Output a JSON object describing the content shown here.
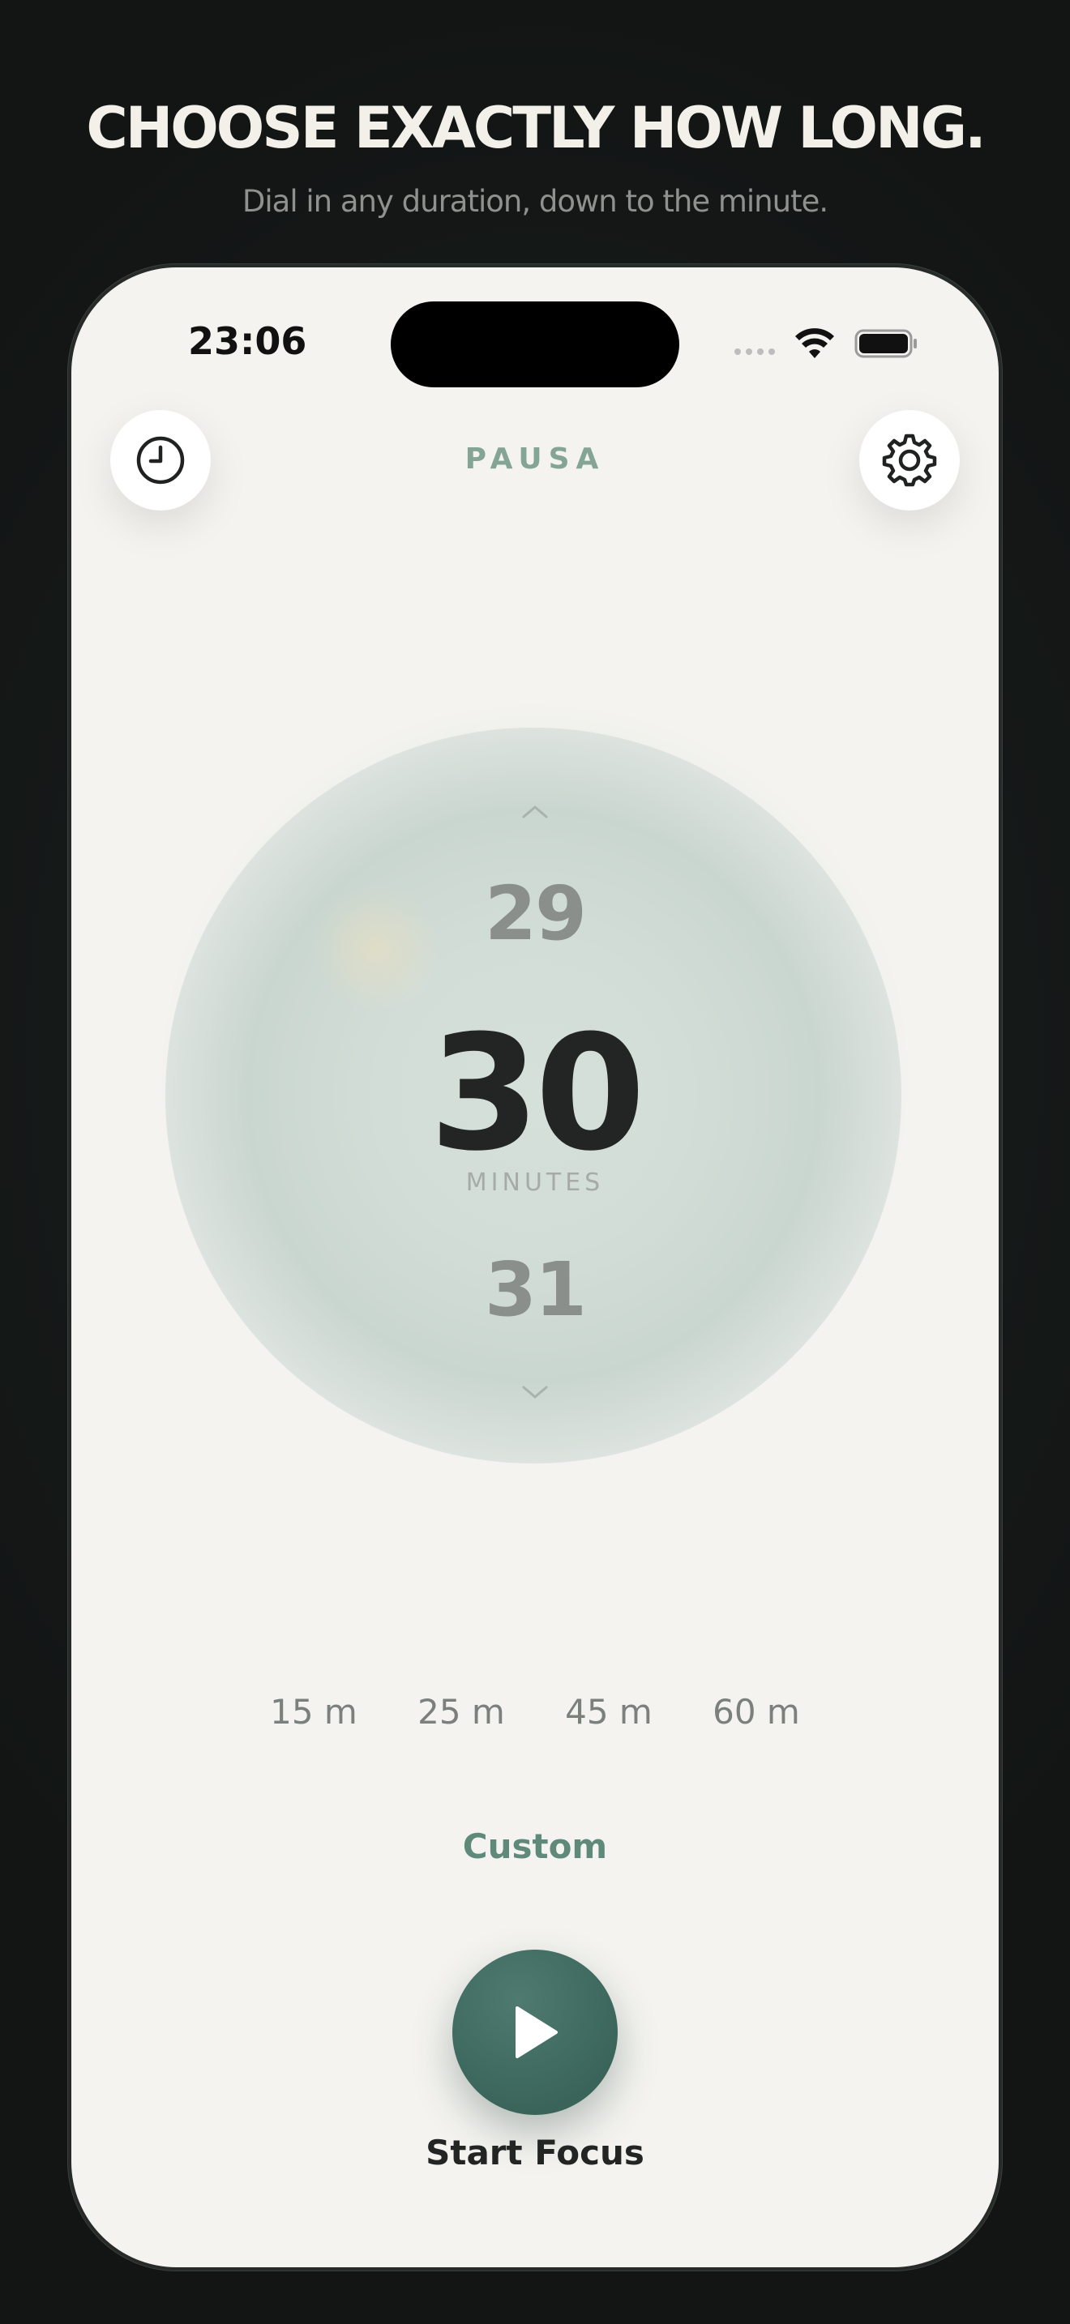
{
  "promo": {
    "headline": "CHOOSE EXACTLY HOW LONG.",
    "subheadline": "Dial in any duration, down to the minute."
  },
  "status_bar": {
    "time": "23:06"
  },
  "header": {
    "app_name": "PAUSA",
    "history_icon": "clock-icon",
    "settings_icon": "gear-icon"
  },
  "dial": {
    "previous": "29",
    "current": "30",
    "unit": "MINUTES",
    "next": "31"
  },
  "presets": [
    "15 m",
    "25 m",
    "45 m",
    "60 m"
  ],
  "custom_label": "Custom",
  "start": {
    "label": "Start Focus",
    "icon": "play-icon"
  },
  "colors": {
    "accent": "#5f8a7a",
    "play_button": "#3f6a60",
    "background": "#f4f3ef"
  }
}
